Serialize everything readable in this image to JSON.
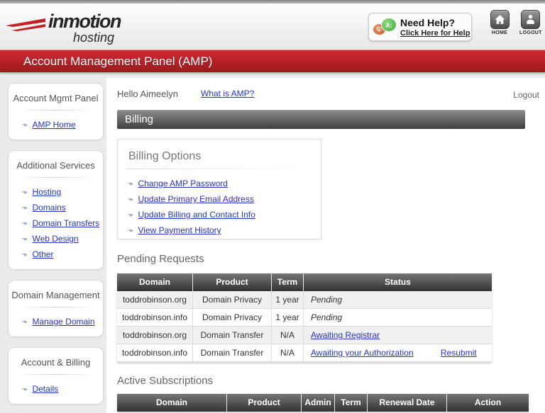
{
  "header": {
    "logo_line1": "inmotion",
    "logo_line2": "hosting",
    "help_title": "Need Help?",
    "help_link": "Click Here for Help",
    "help_q": "Q:",
    "help_a": "A:",
    "home_label": "HOME",
    "logout_label": "LOGOUT"
  },
  "banner": {
    "title": "Account Management Panel (AMP)"
  },
  "sidebar": {
    "sections": [
      {
        "title": "Account Mgmt Panel",
        "links": [
          {
            "label": "AMP Home"
          }
        ]
      },
      {
        "title": "Additional Services",
        "links": [
          {
            "label": "Hosting"
          },
          {
            "label": "Domains"
          },
          {
            "label": "Domain Transfers"
          },
          {
            "label": "Web Design"
          },
          {
            "label": "Other"
          }
        ]
      },
      {
        "title": "Domain Management",
        "links": [
          {
            "label": "Manage Domain"
          }
        ]
      },
      {
        "title": "Account & Billing",
        "links": [
          {
            "label": "Details"
          }
        ]
      }
    ]
  },
  "main": {
    "greeting": "Hello Aimeelyn",
    "what_is_amp_link": "What is AMP?",
    "logout_link": "Logout",
    "page_section_title": "Billing",
    "billing_options": {
      "title": "Billing Options",
      "links": [
        {
          "label": "Change AMP Password"
        },
        {
          "label": "Update Primary Email Address"
        },
        {
          "label": "Update Billing and Contact Info"
        },
        {
          "label": "View Payment History"
        }
      ]
    },
    "pending_requests": {
      "title": "Pending Requests",
      "columns": [
        "Domain",
        "Product",
        "Term",
        "Status"
      ],
      "rows": [
        {
          "domain": "toddrobinson.org",
          "product": "Domain Privacy",
          "term": "1 year",
          "status": "Pending"
        },
        {
          "domain": "toddrobinson.info",
          "product": "Domain Privacy",
          "term": "1 year",
          "status": "Pending"
        },
        {
          "domain": "toddrobinson.org",
          "product": "Domain Transfer",
          "term": "N/A",
          "status": "Awaiting Registrar"
        },
        {
          "domain": "toddrobinson.info",
          "product": "Domain Transfer",
          "term": "N/A",
          "status": "Awaiting your Authorization",
          "extra_action": "Resubmit"
        }
      ]
    },
    "active_subscriptions": {
      "title": "Active Subscriptions",
      "columns": [
        "Domain",
        "Product",
        "Admin",
        "Term",
        "Renewal Date",
        "Action"
      ]
    }
  },
  "colors": {
    "brand_red": "#c42127",
    "link_blue": "#2433cc",
    "section_bar_gray": "#3e3e3e",
    "table_header_gray": "#323232",
    "bubble_green": "#3fae37",
    "bubble_orange": "#c75f2e",
    "page_background": "#ebebeb"
  }
}
